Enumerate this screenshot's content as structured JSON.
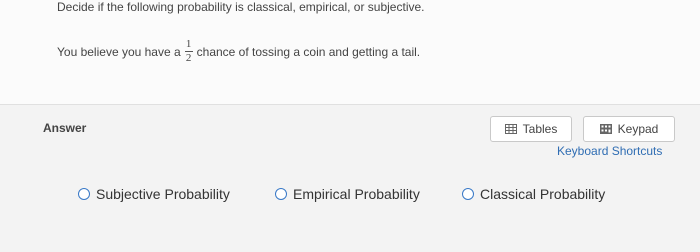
{
  "question": {
    "title": "Decide if the following probability is classical, empirical, or subjective.",
    "prefix": "You believe you have a",
    "fraction": {
      "numerator": "1",
      "denominator": "2"
    },
    "suffix": "chance of tossing a coin and getting a tail."
  },
  "answer": {
    "label": "Answer",
    "tables_label": "Tables",
    "keypad_label": "Keypad",
    "shortcuts_label": "Keyboard Shortcuts",
    "options": [
      {
        "label": "Subjective Probability",
        "selected": false
      },
      {
        "label": "Empirical Probability",
        "selected": false
      },
      {
        "label": "Classical Probability",
        "selected": false
      }
    ]
  },
  "colors": {
    "accent": "#2f6db3",
    "radio_border": "#3979c7"
  },
  "icons": {
    "tables": "table-grid-icon",
    "keypad": "keypad-icon"
  }
}
